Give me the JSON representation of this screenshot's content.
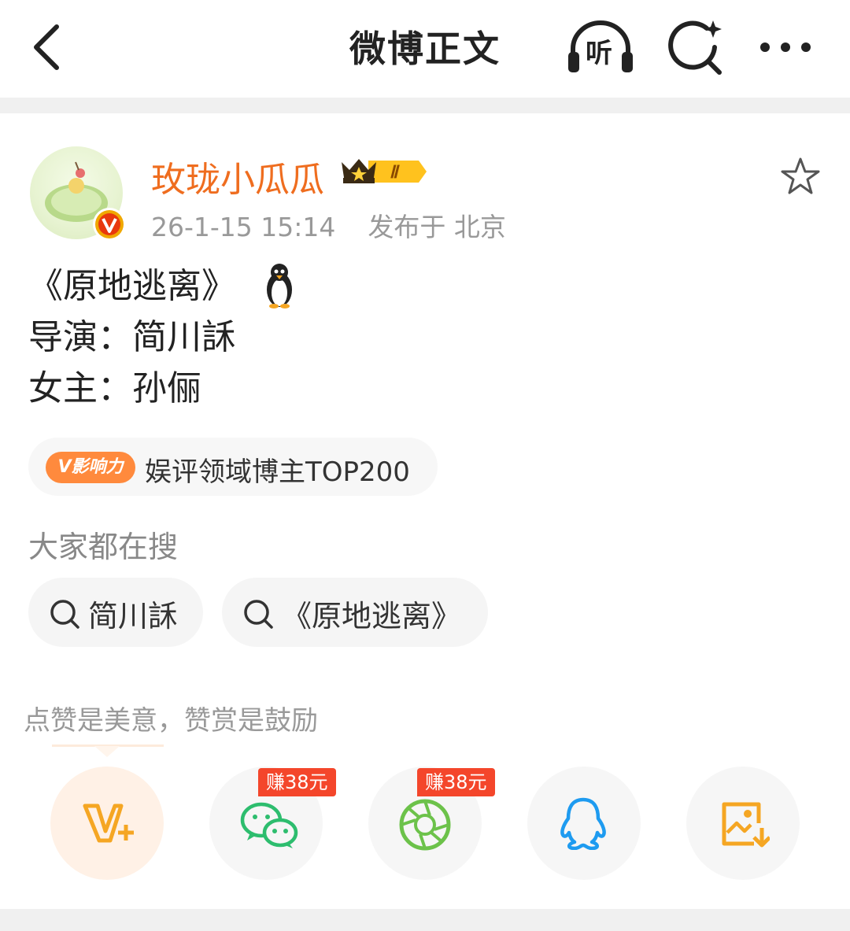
{
  "header": {
    "back_icon": "chevron-left-icon",
    "title": "微博正文",
    "listen_label": "听",
    "listen_icon": "headphones-icon",
    "search_icon": "ai-search-icon",
    "more_icon": "more-horizontal-icon"
  },
  "post": {
    "author": "玫珑小瓜瓜",
    "author_color": "#ef6d1f",
    "vip_level": "Ⅱ",
    "time": "26-1-15 15:14",
    "location": "发布于 北京",
    "content_lines": [
      "《原地逃离》",
      "导演：简川訸",
      "女主：孙俪"
    ],
    "emoji": "penguin-icon"
  },
  "influence": {
    "tag": "V影响力",
    "text": "娱评领域博主TOP200"
  },
  "hot_search": {
    "title": "大家都在搜",
    "chips": [
      "简川訸",
      "《原地逃离》"
    ]
  },
  "reward": {
    "text": "点赞是美意，赞赏是鼓励"
  },
  "share": {
    "items": [
      {
        "icon": "v-plus-icon",
        "color": "#f5a623"
      },
      {
        "icon": "wechat-icon",
        "color": "#2dbd6e",
        "badge": "赚38元"
      },
      {
        "icon": "moments-icon",
        "color": "#6cc24a",
        "badge": "赚38元"
      },
      {
        "icon": "qq-icon",
        "color": "#1e9bf0"
      },
      {
        "icon": "save-image-icon",
        "color": "#f5a623"
      }
    ]
  }
}
